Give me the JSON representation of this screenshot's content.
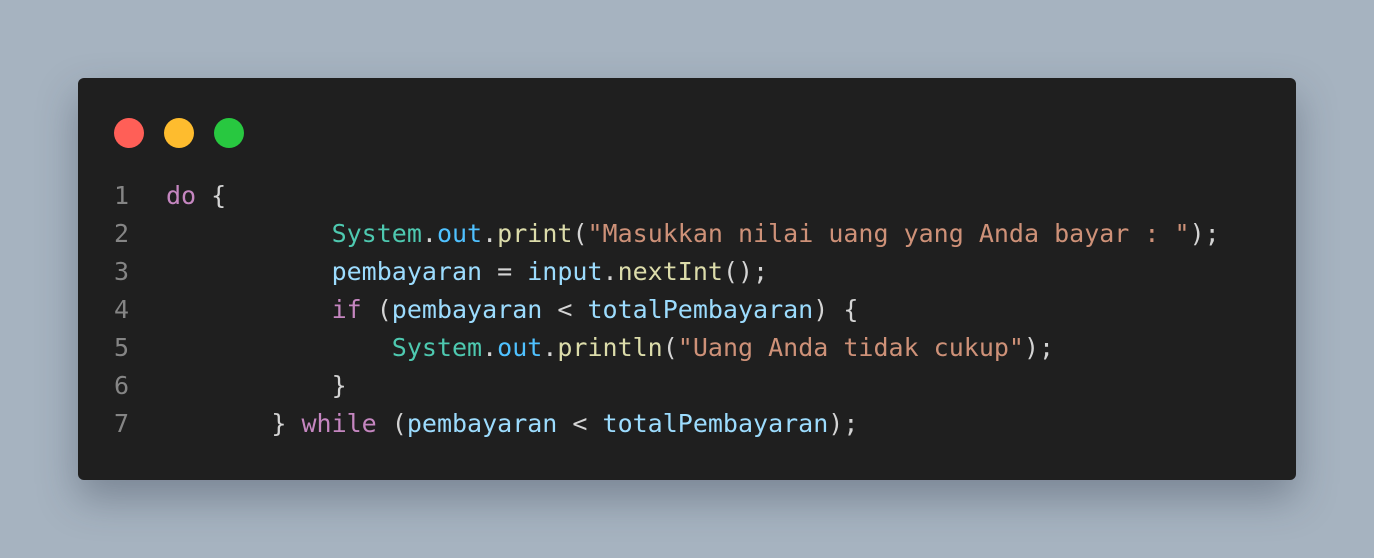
{
  "colors": {
    "background": "#a6b3c0",
    "window": "#1f1f1f",
    "close": "#ff5f57",
    "minimize": "#febc2e",
    "maximize": "#28c840"
  },
  "window_controls": [
    "close-dot",
    "minimize-dot",
    "maximize-dot"
  ],
  "code": {
    "lines": [
      {
        "num": "1",
        "indent": "",
        "tokens": [
          {
            "t": "do",
            "c": "kw"
          },
          {
            "t": " {",
            "c": "pun"
          }
        ]
      },
      {
        "num": "2",
        "indent": "           ",
        "tokens": [
          {
            "t": "System",
            "c": "cls"
          },
          {
            "t": ".",
            "c": "pun"
          },
          {
            "t": "out",
            "c": "fld"
          },
          {
            "t": ".",
            "c": "pun"
          },
          {
            "t": "print",
            "c": "fn"
          },
          {
            "t": "(",
            "c": "pun"
          },
          {
            "t": "\"Masukkan nilai uang yang Anda bayar : \"",
            "c": "str"
          },
          {
            "t": ");",
            "c": "pun"
          }
        ]
      },
      {
        "num": "3",
        "indent": "           ",
        "tokens": [
          {
            "t": "pembayaran",
            "c": "var"
          },
          {
            "t": " = ",
            "c": "pun"
          },
          {
            "t": "input",
            "c": "var"
          },
          {
            "t": ".",
            "c": "pun"
          },
          {
            "t": "nextInt",
            "c": "fn"
          },
          {
            "t": "();",
            "c": "pun"
          }
        ]
      },
      {
        "num": "4",
        "indent": "           ",
        "tokens": [
          {
            "t": "if",
            "c": "kw"
          },
          {
            "t": " (",
            "c": "pun"
          },
          {
            "t": "pembayaran",
            "c": "var"
          },
          {
            "t": " < ",
            "c": "pun"
          },
          {
            "t": "totalPembayaran",
            "c": "var"
          },
          {
            "t": ") {",
            "c": "pun"
          }
        ]
      },
      {
        "num": "5",
        "indent": "               ",
        "tokens": [
          {
            "t": "System",
            "c": "cls"
          },
          {
            "t": ".",
            "c": "pun"
          },
          {
            "t": "out",
            "c": "fld"
          },
          {
            "t": ".",
            "c": "pun"
          },
          {
            "t": "println",
            "c": "fn"
          },
          {
            "t": "(",
            "c": "pun"
          },
          {
            "t": "\"Uang Anda tidak cukup\"",
            "c": "str"
          },
          {
            "t": ");",
            "c": "pun"
          }
        ]
      },
      {
        "num": "6",
        "indent": "           ",
        "tokens": [
          {
            "t": "}",
            "c": "pun"
          }
        ]
      },
      {
        "num": "7",
        "indent": "       ",
        "tokens": [
          {
            "t": "} ",
            "c": "pun"
          },
          {
            "t": "while",
            "c": "kw"
          },
          {
            "t": " (",
            "c": "pun"
          },
          {
            "t": "pembayaran",
            "c": "var"
          },
          {
            "t": " < ",
            "c": "pun"
          },
          {
            "t": "totalPembayaran",
            "c": "var"
          },
          {
            "t": ");",
            "c": "pun"
          }
        ]
      }
    ]
  }
}
